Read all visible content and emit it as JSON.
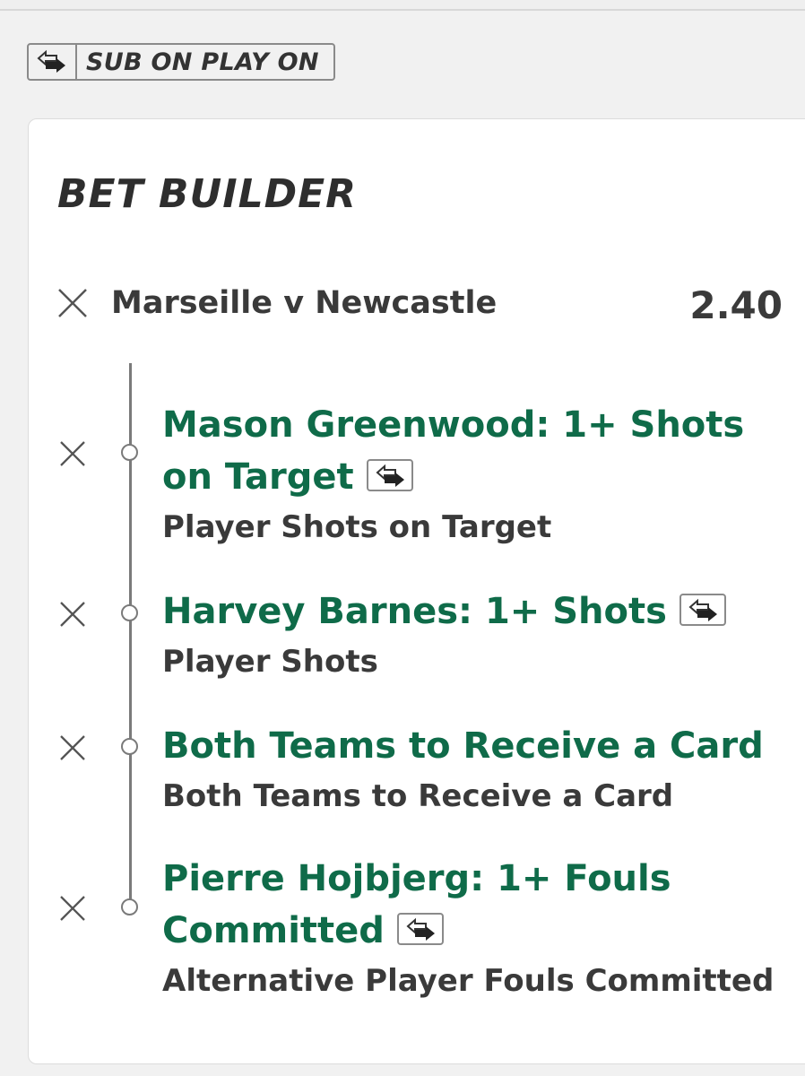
{
  "badge": {
    "label": "SUB ON PLAY ON",
    "icon": "swap-arrows-icon"
  },
  "card": {
    "title": "BET BUILDER",
    "match": "Marseille v Newcastle",
    "odds": "2.40",
    "legs": [
      {
        "selection": "Mason Greenwood: 1+ Shots on Target",
        "market": "Player Shots on Target",
        "sub_on": true
      },
      {
        "selection": "Harvey Barnes: 1+ Shots",
        "market": "Player Shots",
        "sub_on": true
      },
      {
        "selection": "Both Teams to Receive a Card",
        "market": "Both Teams to Receive a Card",
        "sub_on": false
      },
      {
        "selection": "Pierre Hojbjerg: 1+ Fouls Committed",
        "market": "Alternative Player Fouls Committed",
        "sub_on": true
      }
    ]
  },
  "colors": {
    "selection": "#0f6b49",
    "text": "#3a3a3a",
    "background": "#f1f1f1",
    "card": "#ffffff"
  }
}
